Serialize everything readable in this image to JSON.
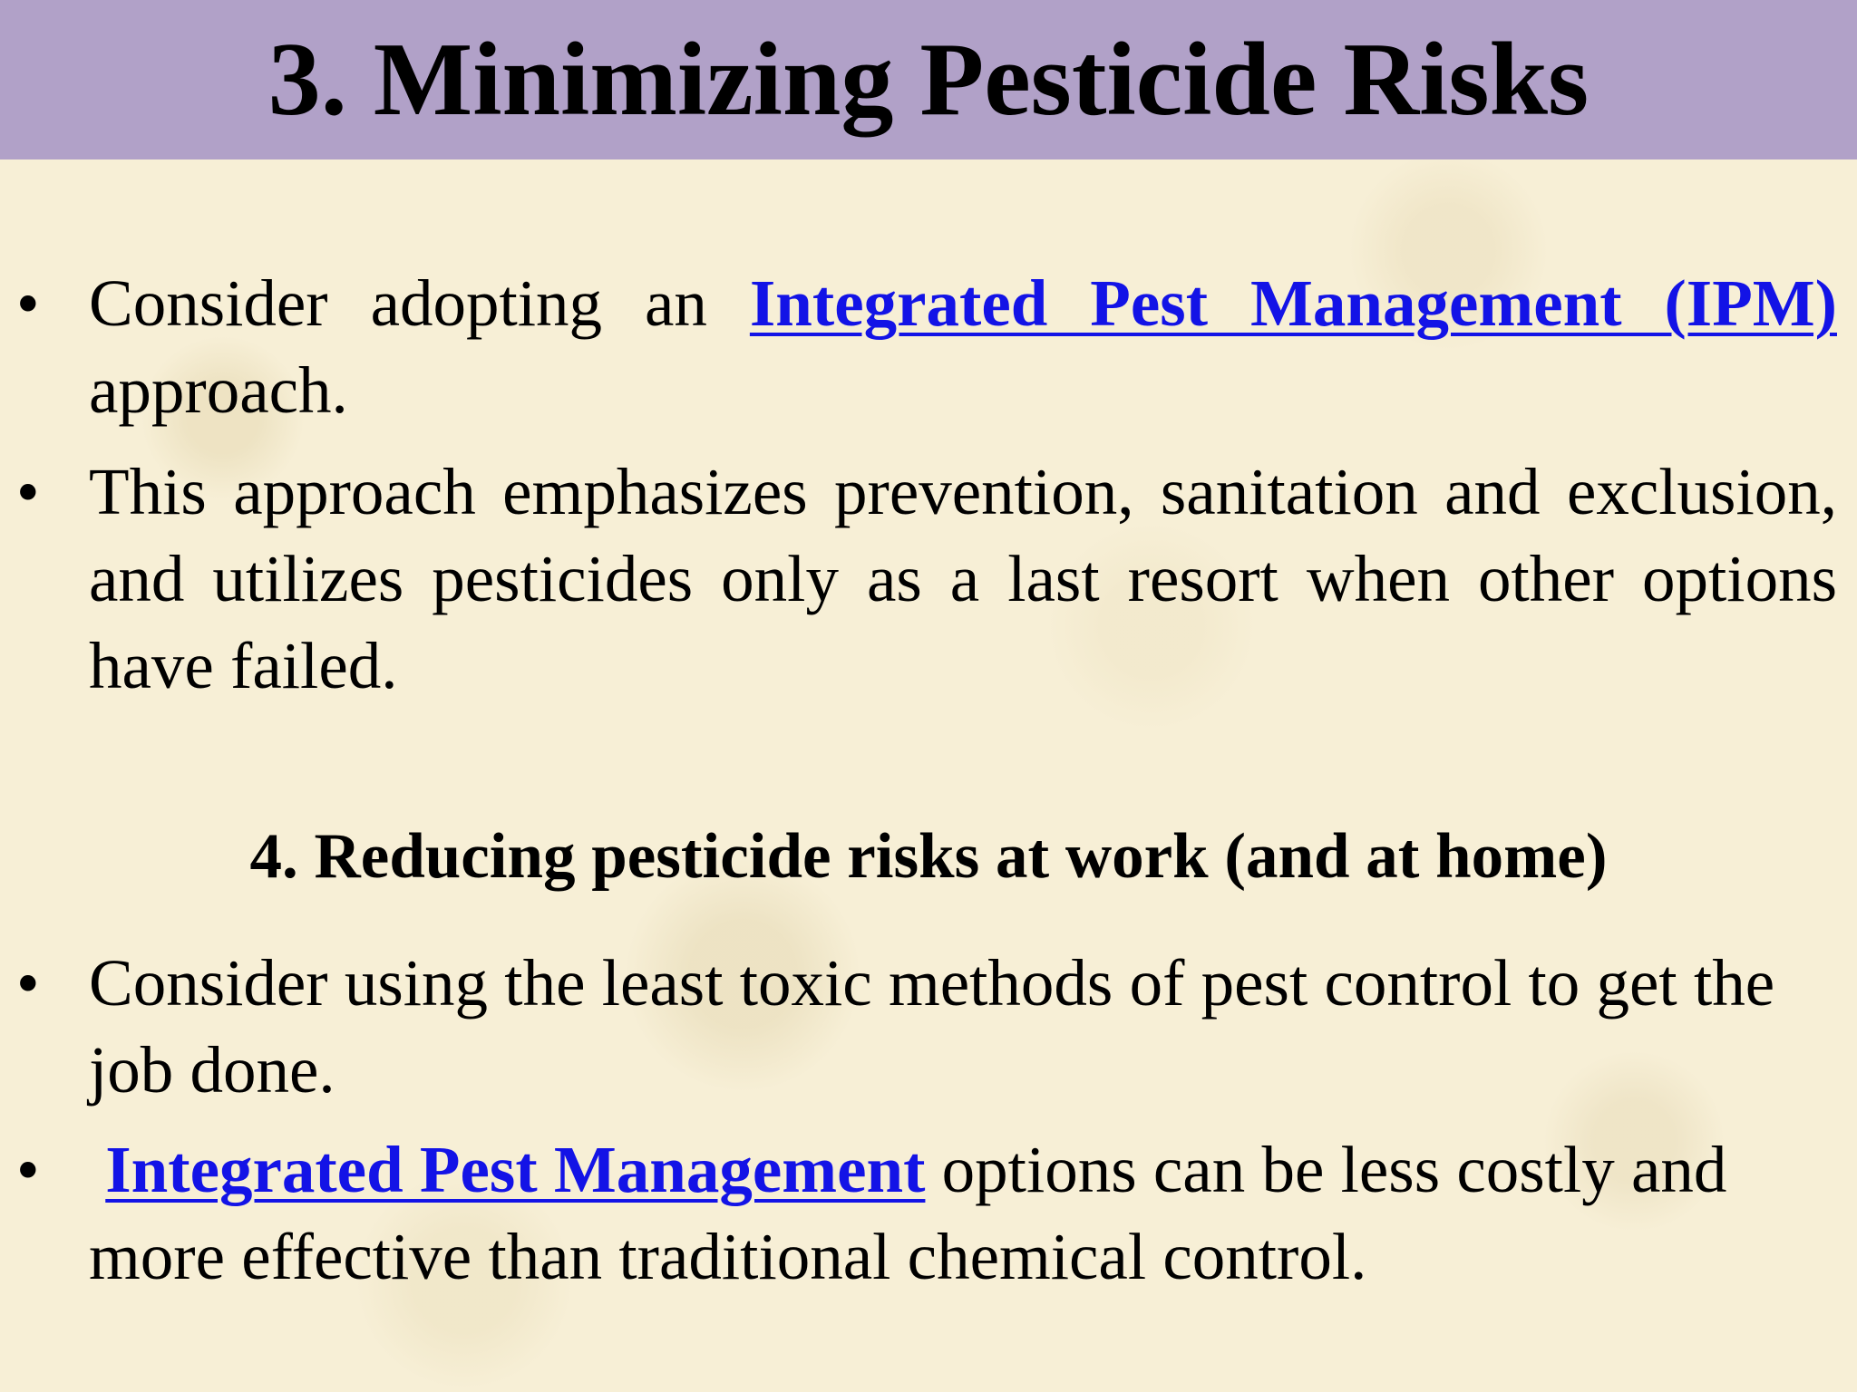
{
  "slide": {
    "title": "3. Minimizing Pesticide Risks",
    "colors": {
      "title_bar": "#b1a1c8",
      "background": "#f7efd6",
      "link": "#1313e6"
    },
    "bullet_glyph": "•",
    "bullets_section3": [
      {
        "text_before": "Consider adopting an ",
        "link_text": "Integrated Pest Management (IPM)",
        "text_after": " approach."
      },
      {
        "text": "This approach emphasizes prevention, sanitation and exclusion, and utilizes pesticides only as a last resort when other options have failed."
      }
    ],
    "subheading": "4. Reducing pesticide risks at work (and at home)",
    "bullets_section4": [
      {
        "text": "Consider using the least toxic methods of pest control to get the job done."
      },
      {
        "link_text": "Integrated Pest Management",
        "text_after": " options can be less costly and more effective than traditional chemical control."
      }
    ]
  }
}
